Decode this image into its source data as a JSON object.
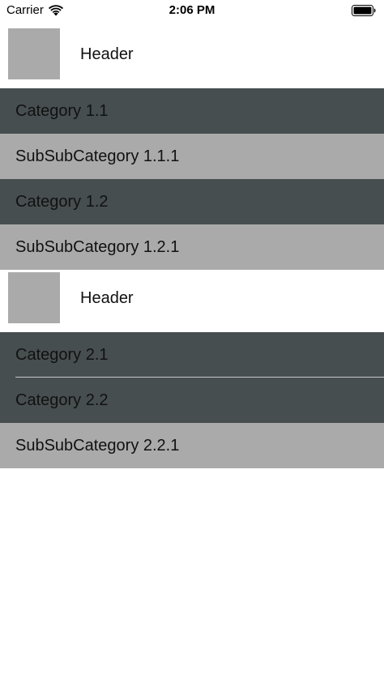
{
  "status_bar": {
    "carrier": "Carrier",
    "time": "2:06 PM"
  },
  "colors": {
    "category_bg": "#474e50",
    "subsub_bg": "#aaaaaa",
    "thumbnail": "#aaaaaa"
  },
  "sections": [
    {
      "header": "Header",
      "rows": [
        {
          "label": "Category 1.1",
          "kind": "category"
        },
        {
          "label": "SubSubCategory 1.1.1",
          "kind": "subsub"
        },
        {
          "label": "Category 1.2",
          "kind": "category"
        },
        {
          "label": "SubSubCategory 1.2.1",
          "kind": "subsub"
        }
      ]
    },
    {
      "header": "Header",
      "rows": [
        {
          "label": "Category 2.1",
          "kind": "category"
        },
        {
          "label": "Category 2.2",
          "kind": "category"
        },
        {
          "label": "SubSubCategory 2.2.1",
          "kind": "subsub"
        }
      ]
    }
  ]
}
